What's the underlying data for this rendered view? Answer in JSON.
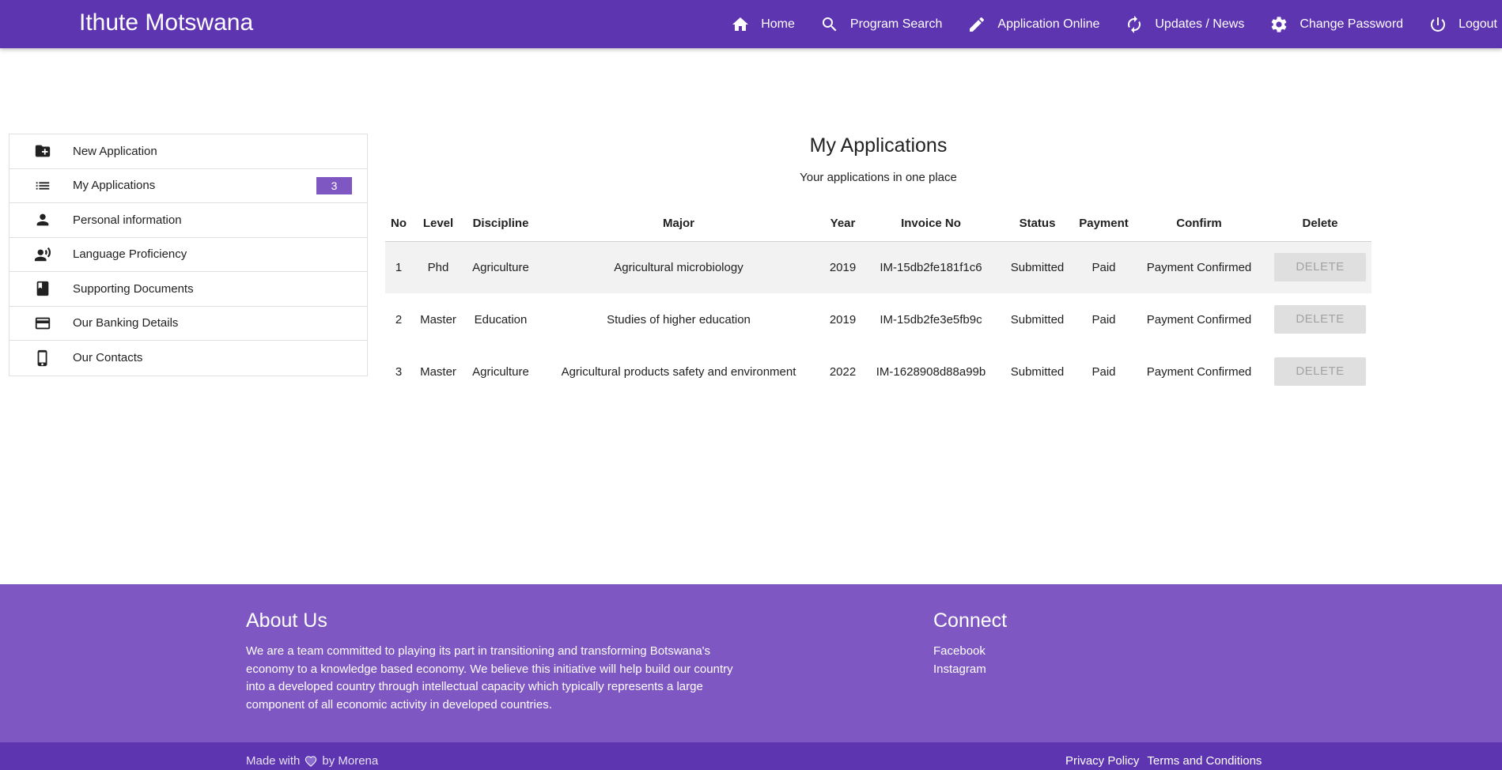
{
  "header": {
    "brand": "Ithute Motswana",
    "nav": [
      {
        "label": "Home",
        "icon": "home-icon"
      },
      {
        "label": "Program Search",
        "icon": "search-icon"
      },
      {
        "label": "Application Online",
        "icon": "pencil-icon"
      },
      {
        "label": "Updates / News",
        "icon": "refresh-icon"
      },
      {
        "label": "Change Password",
        "icon": "gear-icon"
      },
      {
        "label": "Logout",
        "icon": "power-icon"
      }
    ]
  },
  "sidebar": {
    "items": [
      {
        "label": "New Application",
        "icon": "folder-plus-icon"
      },
      {
        "label": "My Applications",
        "icon": "list-icon",
        "badge": "3"
      },
      {
        "label": "Personal information",
        "icon": "person-icon"
      },
      {
        "label": "Language Proficiency",
        "icon": "voice-person-icon"
      },
      {
        "label": "Supporting Documents",
        "icon": "book-icon"
      },
      {
        "label": "Our Banking Details",
        "icon": "credit-card-icon"
      },
      {
        "label": "Our Contacts",
        "icon": "phone-icon"
      }
    ]
  },
  "main": {
    "title": "My Applications",
    "subtitle": "Your applications in one place",
    "columns": [
      "No",
      "Level",
      "Discipline",
      "Major",
      "Year",
      "Invoice No",
      "Status",
      "Payment",
      "Confirm",
      "Delete"
    ],
    "rows": [
      {
        "no": "1",
        "level": "Phd",
        "discipline": "Agriculture",
        "major": "Agricultural microbiology",
        "year": "2019",
        "invoice": "IM-15db2fe181f1c6",
        "status": "Submitted",
        "payment": "Paid",
        "confirm": "Payment Confirmed",
        "delete": "DELETE"
      },
      {
        "no": "2",
        "level": "Master",
        "discipline": "Education",
        "major": "Studies of higher education",
        "year": "2019",
        "invoice": "IM-15db2fe3e5fb9c",
        "status": "Submitted",
        "payment": "Paid",
        "confirm": "Payment Confirmed",
        "delete": "DELETE"
      },
      {
        "no": "3",
        "level": "Master",
        "discipline": "Agriculture",
        "major": "Agricultural products safety and environment",
        "year": "2022",
        "invoice": "IM-1628908d88a99b",
        "status": "Submitted",
        "payment": "Paid",
        "confirm": "Payment Confirmed",
        "delete": "DELETE"
      }
    ]
  },
  "footer": {
    "about_title": "About Us",
    "about_text": "We are a team committed to playing its part in transitioning and transforming Botswana's economy to a knowledge based economy. We believe this initiative will help build our country into a developed country through intellectual capacity which typically represents a large component of all economic activity in developed countries.",
    "connect_title": "Connect",
    "connect_links": [
      "Facebook",
      "Instagram"
    ],
    "made_prefix": "Made with",
    "made_suffix": "by Morena",
    "legal_links": [
      "Privacy Policy",
      "Terms and Conditions"
    ]
  },
  "colors": {
    "header_bg": "#5e35b1",
    "footer_bg": "#7e57c2",
    "badge_bg": "#7e57c2"
  }
}
